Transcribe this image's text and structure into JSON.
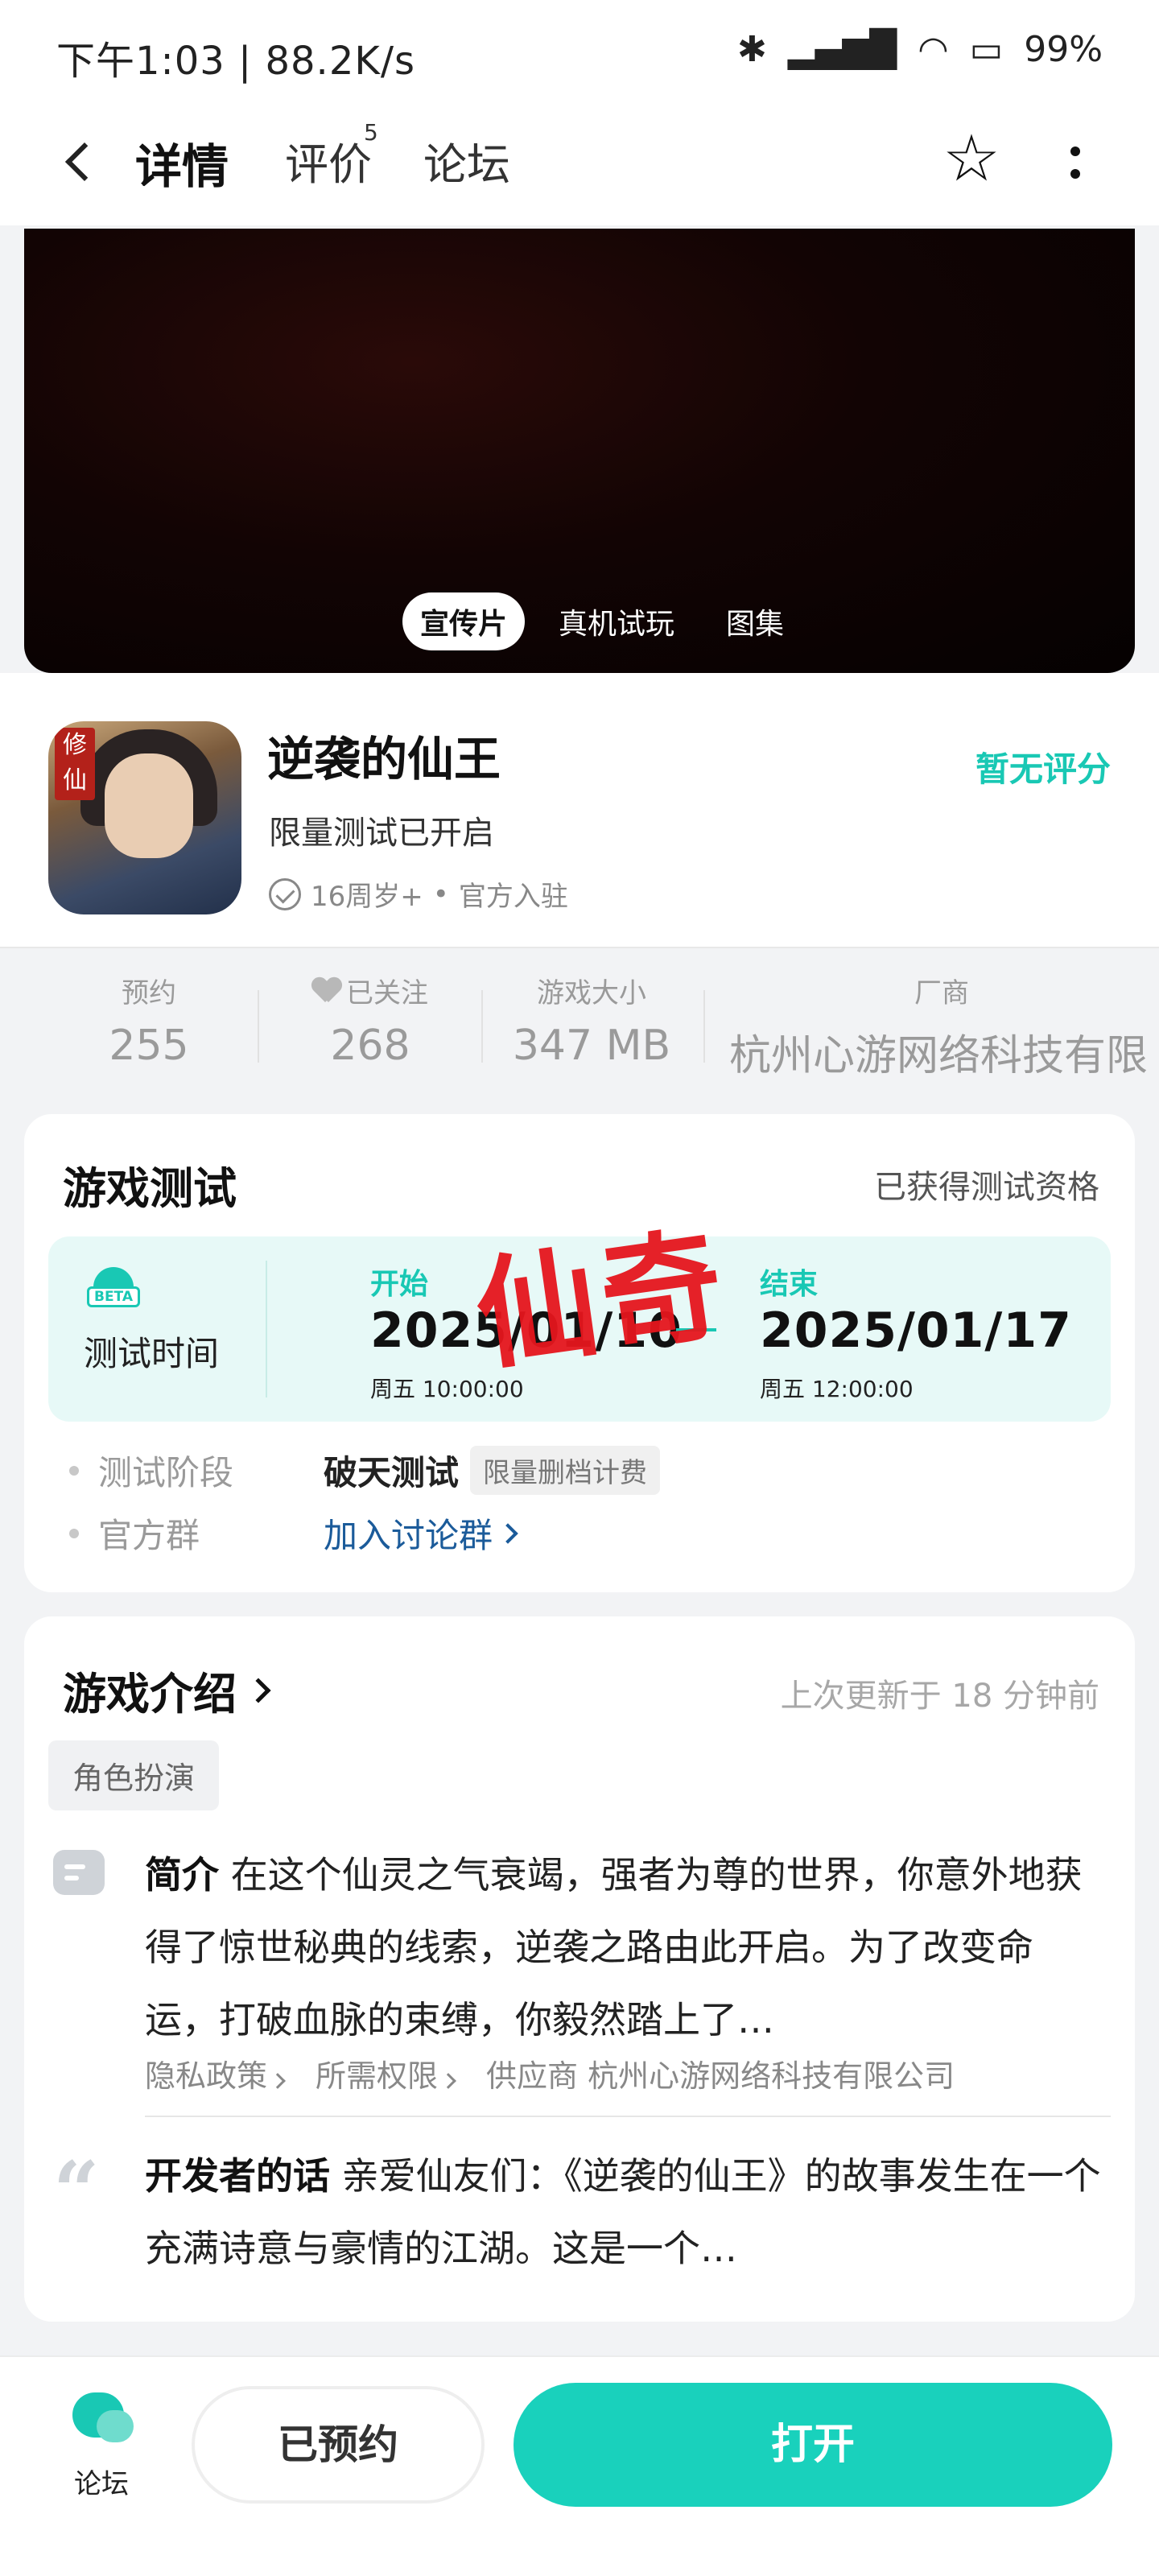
{
  "status_bar": {
    "time": "下午1:03 | 88.2K/s",
    "battery": "99%"
  },
  "nav": {
    "tabs": [
      {
        "label": "详情"
      },
      {
        "label": "评价"
      },
      {
        "label": "论坛"
      }
    ],
    "reviews_badge": "5"
  },
  "media": {
    "segments": [
      "宣传片",
      "真机试玩",
      "图集"
    ]
  },
  "app": {
    "name": "逆袭的仙王",
    "subtitle": "限量测试已开启",
    "age": "16周岁+",
    "official": "官方入驻",
    "rating": "暂无评分",
    "icon_text": "修仙"
  },
  "stats": [
    {
      "label": "预约",
      "value": "255"
    },
    {
      "label": "已关注",
      "value": "268"
    },
    {
      "label": "游戏大小",
      "value": "347 MB"
    },
    {
      "label": "厂商",
      "value": "杭州心游网络科技有限"
    }
  ],
  "test": {
    "title": "游戏测试",
    "qualified": "已获得测试资格",
    "label": "测试时间",
    "start_label": "开始",
    "start_date": "2025/01/10",
    "start_time": "周五  10:00:00",
    "end_label": "结束",
    "end_date": "2025/01/17",
    "end_time": "周五  12:00:00",
    "stage_key": "测试阶段",
    "stage_val": "破天测试",
    "stage_tag": "限量删档计费",
    "group_key": "官方群",
    "group_link": "加入讨论群",
    "stamp": "仙奇"
  },
  "intro": {
    "title": "游戏介绍",
    "updated": "上次更新于 18 分钟前",
    "genre": "角色扮演",
    "summary_label": "简介",
    "summary_text": " 在这个仙灵之气衰竭，强者为尊的世界，你意外地获得了惊世秘典的线索，逆袭之路由此开启。为了改变命运，打破血脉的束缚，你毅然踏上了…",
    "privacy": "隐私政策",
    "permissions": "所需权限",
    "vendor": "供应商 杭州心游网络科技有限公司",
    "dev_label": "开发者的话",
    "dev_text": " 亲爱仙友们：《逆袭的仙王》的故事发生在一个充满诗意与豪情的江湖。这是一个…"
  },
  "bottom": {
    "forum": "论坛",
    "reserved": "已预约",
    "open": "打开"
  },
  "colors": {
    "accent": "#19c8b4",
    "link": "#1b5b9a",
    "stamp": "#e5161d"
  }
}
